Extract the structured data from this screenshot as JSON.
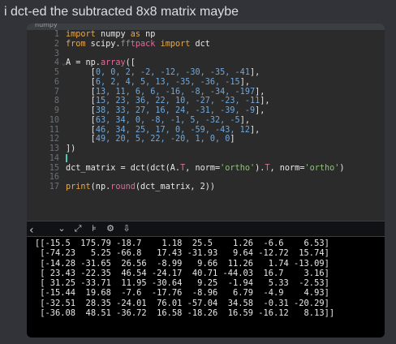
{
  "message": {
    "text": "i dct-ed the subtracted 8x8 matrix maybe"
  },
  "editor": {
    "tab_label": "numpy",
    "lines": [
      {
        "n": "1",
        "parts": [
          [
            "kw",
            "import "
          ],
          [
            "mod",
            "numpy "
          ],
          [
            "kw",
            "as "
          ],
          [
            "mod",
            "np"
          ]
        ]
      },
      {
        "n": "2",
        "parts": [
          [
            "kw",
            "from "
          ],
          [
            "mod",
            "scipy."
          ],
          [
            "cur",
            "fftpack "
          ],
          [
            "kw",
            "import "
          ],
          [
            "mod",
            "dct"
          ]
        ]
      },
      {
        "n": "3",
        "parts": []
      },
      {
        "n": "4",
        "fold": true,
        "parts": [
          [
            "src",
            "A = np."
          ],
          [
            "cur",
            "array"
          ],
          [
            "src",
            "(["
          ]
        ]
      },
      {
        "n": "5",
        "parts": [
          [
            "src",
            "     ["
          ],
          [
            "num",
            "0, 0, 2, -2, -12, -30, -35, -41"
          ],
          [
            "src",
            "],"
          ]
        ]
      },
      {
        "n": "6",
        "parts": [
          [
            "src",
            "     ["
          ],
          [
            "num",
            "6, 2, 4, 5, 13, -35, -36, -15"
          ],
          [
            "src",
            "],"
          ]
        ]
      },
      {
        "n": "7",
        "parts": [
          [
            "src",
            "     ["
          ],
          [
            "num",
            "13, 11, 6, 6, -16, -8, -34, -197"
          ],
          [
            "src",
            "],"
          ]
        ]
      },
      {
        "n": "8",
        "parts": [
          [
            "src",
            "     ["
          ],
          [
            "num",
            "15, 23, 36, 22, 10, -27, -23, -11"
          ],
          [
            "src",
            "],"
          ]
        ]
      },
      {
        "n": "9",
        "parts": [
          [
            "src",
            "     ["
          ],
          [
            "num",
            "38, 33, 27, 16, 24, -31, -39, -9"
          ],
          [
            "src",
            "],"
          ]
        ]
      },
      {
        "n": "10",
        "parts": [
          [
            "src",
            "     ["
          ],
          [
            "num",
            "63, 34, 0, -8, -1, 5, -32, -5"
          ],
          [
            "src",
            "],"
          ]
        ]
      },
      {
        "n": "11",
        "parts": [
          [
            "src",
            "     ["
          ],
          [
            "num",
            "46, 34, 25, 17, 0, -59, -43, 12"
          ],
          [
            "src",
            "],"
          ]
        ]
      },
      {
        "n": "12",
        "parts": [
          [
            "src",
            "     ["
          ],
          [
            "num",
            "49, 20, 5, 22, -20, 1, 0, 0"
          ],
          [
            "src",
            "]"
          ]
        ]
      },
      {
        "n": "13",
        "parts": [
          [
            "src",
            "])"
          ]
        ]
      },
      {
        "n": "14",
        "caret": true,
        "parts": []
      },
      {
        "n": "15",
        "parts": [
          [
            "src",
            "dct_matrix = dct(dct(A."
          ],
          [
            "cur",
            "T"
          ],
          [
            "src",
            ", norm="
          ],
          [
            "str",
            "'ortho'"
          ],
          [
            "src",
            ")."
          ],
          [
            "cur",
            "T"
          ],
          [
            "src",
            ", norm="
          ],
          [
            "str",
            "'ortho'"
          ],
          [
            "src",
            ")"
          ]
        ]
      },
      {
        "n": "16",
        "parts": []
      },
      {
        "n": "17",
        "parts": [
          [
            "kw",
            "print"
          ],
          [
            "src",
            "(np."
          ],
          [
            "cur",
            "round"
          ],
          [
            "src",
            "(dct_matrix, 2))"
          ]
        ]
      }
    ]
  },
  "console": {
    "icons": [
      "chevron-down-icon",
      "expand-icon",
      "wrap-icon",
      "settings-icon",
      "clear-icon"
    ],
    "icon_glyphs": [
      "⌄",
      "⤢",
      "⊧",
      "⚙",
      "⇩"
    ],
    "collapse_glyph": "‹",
    "output": [
      "[[-15.5  175.79 -18.7    1.18  25.5    1.26  -6.6    6.53]",
      " [-74.23   5.25 -66.8   17.43 -31.93   9.64 -12.72  15.74]",
      " [-14.28 -31.65  26.56  -8.99   9.66  11.26   1.74 -13.09]",
      " [ 23.43 -22.35  46.54 -24.17  40.71 -44.03  16.7    3.16]",
      " [ 31.25 -33.71  11.95 -30.64   9.25  -1.94   5.33  -2.53]",
      " [-15.44  19.68  -7.6  -17.76  -8.96   6.79  -4.9    4.93]",
      " [-32.51  28.35 -24.01  76.01 -57.04  34.58  -0.31 -20.29]",
      " [-36.08  48.51 -36.72  16.58 -18.26  16.59 -16.12   8.13]]"
    ]
  }
}
